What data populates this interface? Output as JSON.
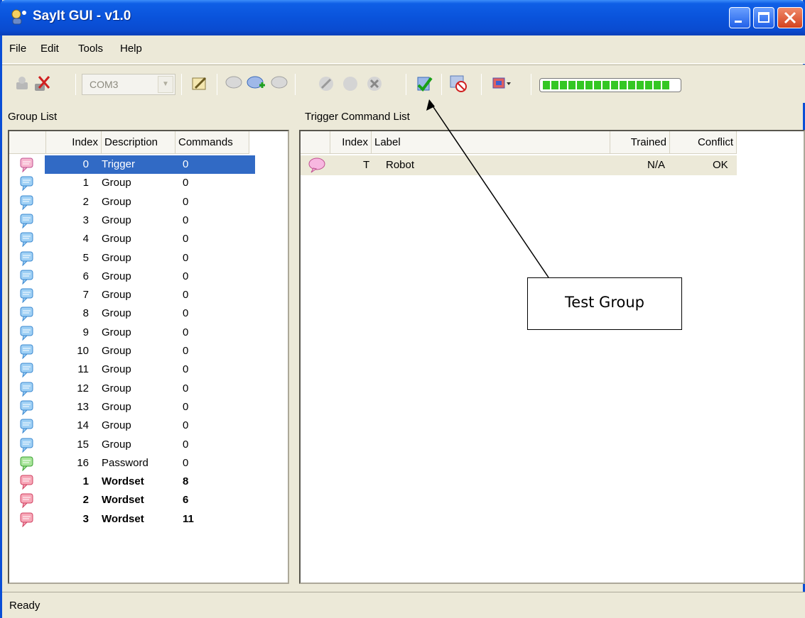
{
  "window": {
    "title": "SayIt GUI - v1.0"
  },
  "menu": [
    "File",
    "Edit",
    "Tools",
    "Help"
  ],
  "toolbar": {
    "com_port": "COM3"
  },
  "group_list": {
    "label": "Group List",
    "columns": [
      "Index",
      "Description",
      "Commands"
    ],
    "rows": [
      {
        "index": "0",
        "description": "Trigger",
        "commands": "0",
        "selected": true
      },
      {
        "index": "1",
        "description": "Group",
        "commands": "0"
      },
      {
        "index": "2",
        "description": "Group",
        "commands": "0"
      },
      {
        "index": "3",
        "description": "Group",
        "commands": "0"
      },
      {
        "index": "4",
        "description": "Group",
        "commands": "0"
      },
      {
        "index": "5",
        "description": "Group",
        "commands": "0"
      },
      {
        "index": "6",
        "description": "Group",
        "commands": "0"
      },
      {
        "index": "7",
        "description": "Group",
        "commands": "0"
      },
      {
        "index": "8",
        "description": "Group",
        "commands": "0"
      },
      {
        "index": "9",
        "description": "Group",
        "commands": "0"
      },
      {
        "index": "10",
        "description": "Group",
        "commands": "0"
      },
      {
        "index": "11",
        "description": "Group",
        "commands": "0"
      },
      {
        "index": "12",
        "description": "Group",
        "commands": "0"
      },
      {
        "index": "13",
        "description": "Group",
        "commands": "0"
      },
      {
        "index": "14",
        "description": "Group",
        "commands": "0"
      },
      {
        "index": "15",
        "description": "Group",
        "commands": "0"
      },
      {
        "index": "16",
        "description": "Password",
        "commands": "0"
      },
      {
        "index": "1",
        "description": "Wordset",
        "commands": "8",
        "bold": true
      },
      {
        "index": "2",
        "description": "Wordset",
        "commands": "6",
        "bold": true
      },
      {
        "index": "3",
        "description": "Wordset",
        "commands": "11",
        "bold": true
      }
    ]
  },
  "trigger_list": {
    "label": "Trigger Command List",
    "columns": [
      "Index",
      "Label",
      "Trained",
      "Conflict"
    ],
    "rows": [
      {
        "index": "T",
        "label": "Robot",
        "trained": "N/A",
        "conflict": "OK"
      }
    ]
  },
  "status": "Ready",
  "callout": "Test Group",
  "colors": {
    "selection": "#316ac5",
    "titlebar": "#0a53db",
    "progress": "#34c724"
  },
  "icons": {
    "group_row": "speech-bubble-blue-icon",
    "password_row": "speech-bubble-green-icon",
    "wordset_row": "speech-bubble-red-icon",
    "trigger_cmd": "speech-bubble-pink-icon"
  }
}
